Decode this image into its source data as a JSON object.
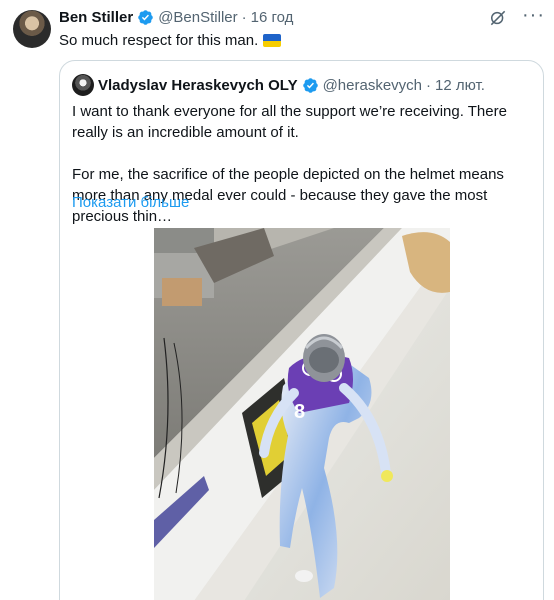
{
  "tweet": {
    "author_name": "Ben Stiller",
    "author_handle": "@BenStiller",
    "separator": "·",
    "time": "16 год",
    "text": "So much respect for this man.",
    "flag_icon": "ukraine-flag-icon"
  },
  "quoted": {
    "author_name": "Vladyslav Heraskevych OLY",
    "author_handle": "@heraskevych",
    "separator": "·",
    "time": "12 лют.",
    "paragraph1": "I want to thank everyone for all the support we’re receiving. There really is an incredible amount of it.",
    "paragraph2": "For me, the sacrifice of the people depicted on the helmet means more than any medal ever could - because they gave the most precious thin…",
    "show_more": "Показати більше",
    "photo_number": "8"
  },
  "colors": {
    "text": "#0f1419",
    "secondary": "#536471",
    "link": "#1d9bf0",
    "verified": "#1d9bf0",
    "border": "#cfd9de"
  },
  "icons": [
    "verified-badge-icon",
    "grok-icon",
    "more-icon",
    "ukraine-flag-icon"
  ]
}
